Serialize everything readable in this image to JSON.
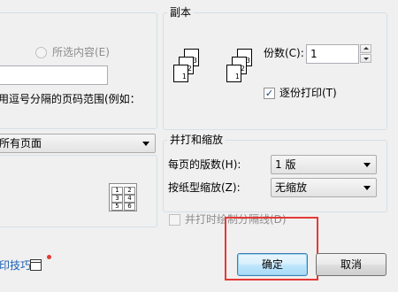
{
  "page_range": {
    "selection_label": "所选内容(E)",
    "pages_value": "",
    "hint_text": "用逗号分隔的页码范围(例如：",
    "print_what_value": "所有页面"
  },
  "copies": {
    "group_label": "副本",
    "copies_label": "份数(C):",
    "copies_value": "1",
    "collate_label": "逐份打印(T)",
    "collate_checked": true,
    "page_numbers": [
      "1",
      "2",
      "3"
    ]
  },
  "zoom": {
    "group_label": "并打和缩放",
    "pages_per_sheet_label": "每页的版数(H):",
    "pages_per_sheet_value": "1 版",
    "scale_label": "按纸型缩放(Z):",
    "scale_value": "无缩放",
    "separator_label": "并打时绘制分隔线(D)",
    "layout_cells": [
      "1",
      "2",
      "3",
      "4",
      "5",
      "6"
    ]
  },
  "footer": {
    "tips_label": "印技巧",
    "ok_label": "确定",
    "cancel_label": "取消"
  },
  "colors": {
    "highlight": "#e53935",
    "link": "#1a5fb4",
    "notification_dot": "#e53935"
  }
}
